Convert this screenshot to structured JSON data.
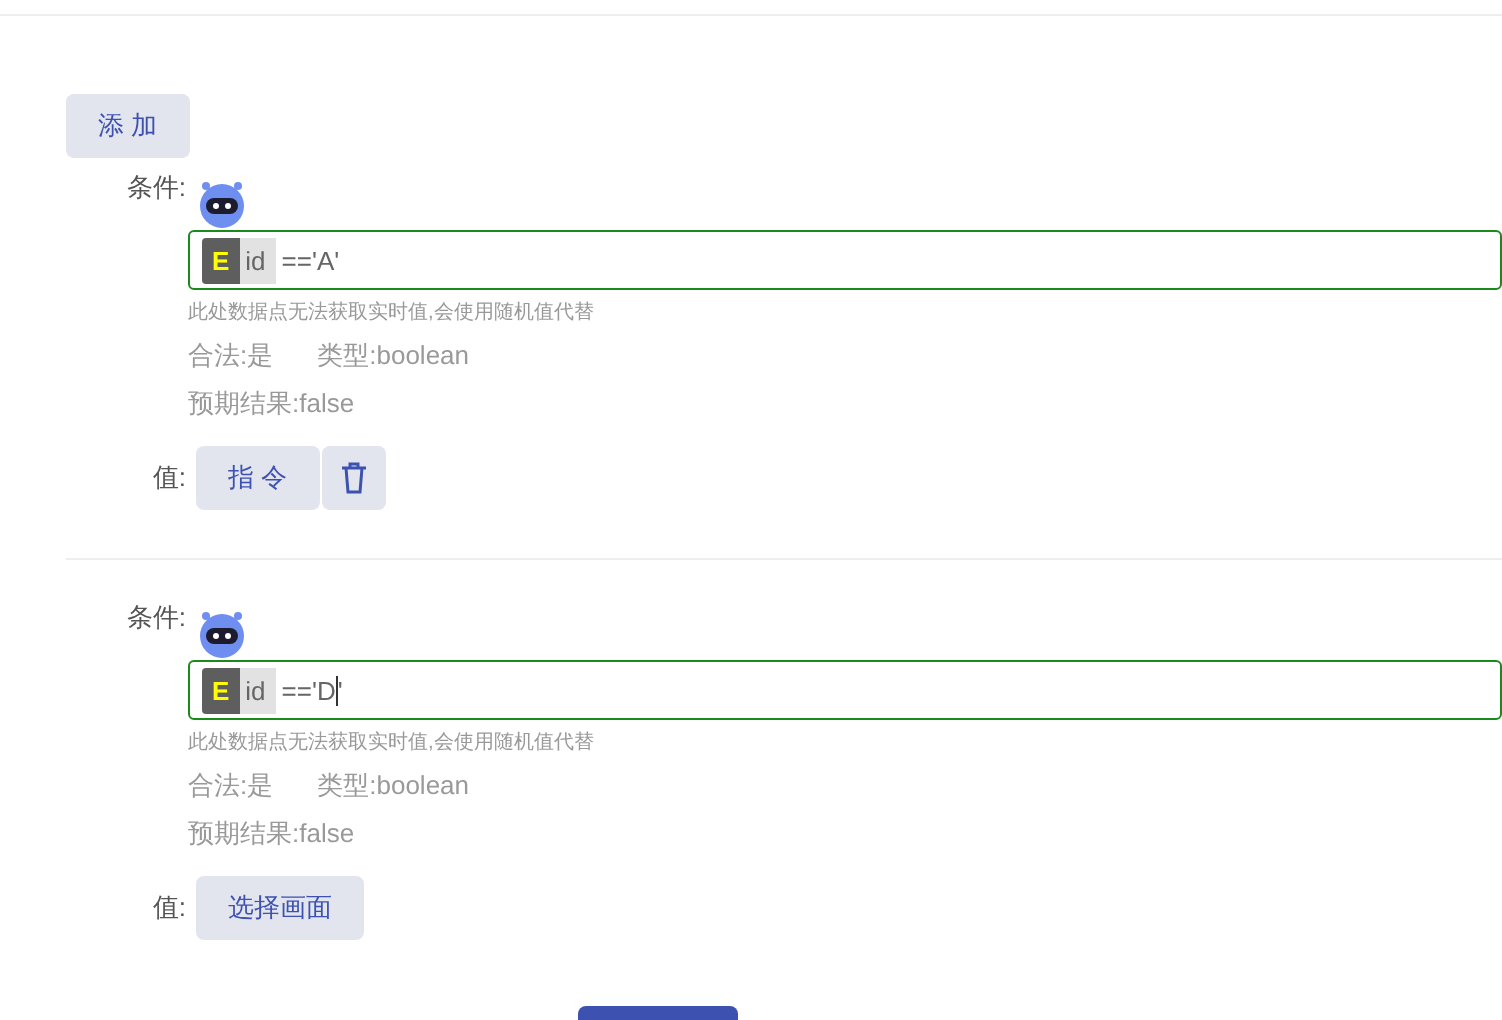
{
  "add_button": {
    "label": "添 加"
  },
  "rules": [
    {
      "condition_label": "条件:",
      "token_badge": "E",
      "token_name": "id",
      "expression": "=='A'",
      "focused": false,
      "hint": "此处数据点无法获取实时值,会使用随机值代替",
      "valid": "合法:是",
      "type": "类型:boolean",
      "expected": "预期结果:false",
      "value_label": "值:",
      "value_button": "指 令",
      "deletable": true
    },
    {
      "condition_label": "条件:",
      "token_badge": "E",
      "token_name": "id",
      "expression": "=='D'",
      "focused": true,
      "hint": "此处数据点无法获取实时值,会使用随机值代替",
      "valid": "合法:是",
      "type": "类型:boolean",
      "expected": "预期结果:false",
      "value_label": "值:",
      "value_button": "选择画面",
      "deletable": false
    }
  ]
}
